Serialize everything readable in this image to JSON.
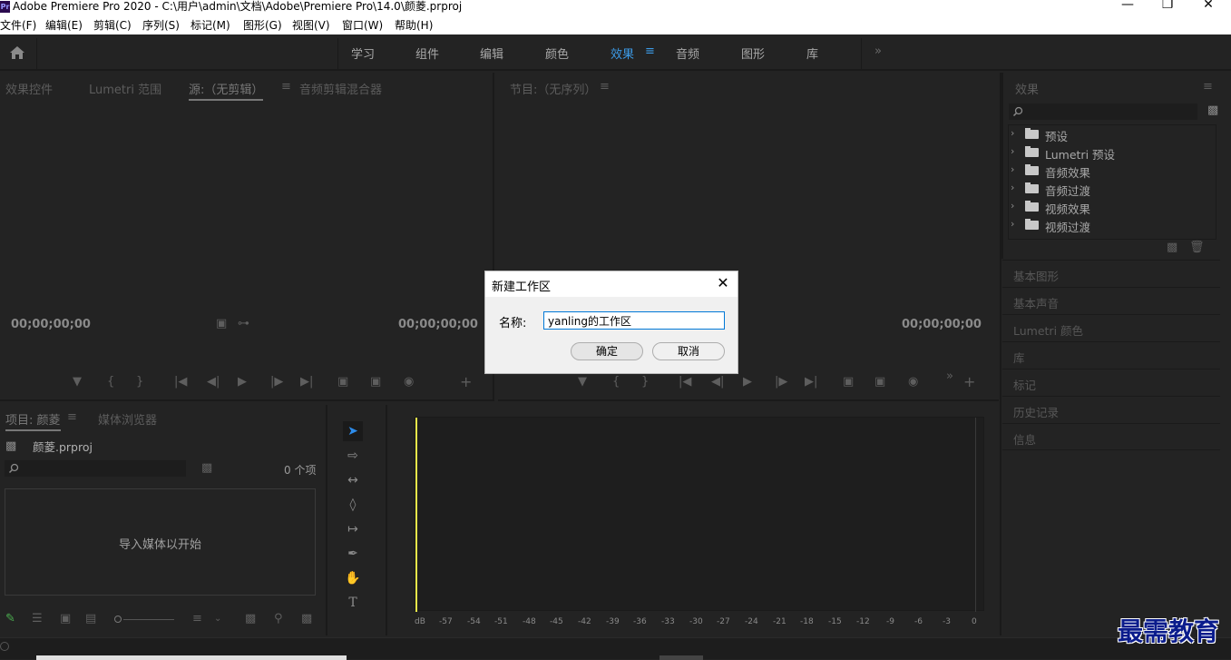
{
  "window": {
    "title": "Adobe Premiere Pro 2020 - C:\\用户\\admin\\文档\\Adobe\\Premiere Pro\\14.0\\颜菱.prproj",
    "app_badge": "Pr"
  },
  "menu": [
    "文件(F)",
    "编辑(E)",
    "剪辑(C)",
    "序列(S)",
    "标记(M)",
    "图形(G)",
    "视图(V)",
    "窗口(W)",
    "帮助(H)"
  ],
  "workspaces": {
    "tabs": [
      "学习",
      "组件",
      "编辑",
      "颜色",
      "效果",
      "音频",
      "图形",
      "库"
    ],
    "active": "效果",
    "overflow": "»"
  },
  "source_panel": {
    "tabs": [
      "效果控件",
      "Lumetri 范围",
      "源:（无剪辑）",
      "音频剪辑混合器"
    ],
    "active_tab": "源:（无剪辑）",
    "timecode_left": "00;00;00;00",
    "timecode_right": "00;00;00;00"
  },
  "program_panel": {
    "tab": "节目:（无序列）",
    "timecode_right": "00;00;00;00"
  },
  "project_panel": {
    "tabs": [
      "项目: 颜菱",
      "媒体浏览器"
    ],
    "active_tab": "项目: 颜菱",
    "file_name": "颜菱.prproj",
    "item_count": "0 个项",
    "empty_hint": "导入媒体以开始"
  },
  "effects_panel": {
    "title": "效果",
    "items": [
      "预设",
      "Lumetri 预设",
      "音频效果",
      "音频过渡",
      "视频效果",
      "视频过渡"
    ]
  },
  "right_sections": [
    "基本图形",
    "基本声音",
    "Lumetri 颜色",
    "库",
    "标记",
    "历史记录",
    "信息"
  ],
  "dialog": {
    "title": "新建工作区",
    "close": "✕",
    "name_label": "名称:",
    "name_value": "yanling的工作区",
    "ok_label": "确定",
    "cancel_label": "取消"
  },
  "audio_meter": {
    "ticks": [
      "dB",
      "-57",
      "-54",
      "-51",
      "-48",
      "-45",
      "-42",
      "-39",
      "-36",
      "-33",
      "-30",
      "-27",
      "-24",
      "-21",
      "-18",
      "-15",
      "-12",
      "-9",
      "-6",
      "-3",
      "0"
    ]
  },
  "watermark": "最需教育",
  "colors": {
    "accent": "#3c9ae6",
    "panel_bg": "#232323",
    "divider": "#1a1a1a",
    "playhead": "#e8e84a"
  }
}
